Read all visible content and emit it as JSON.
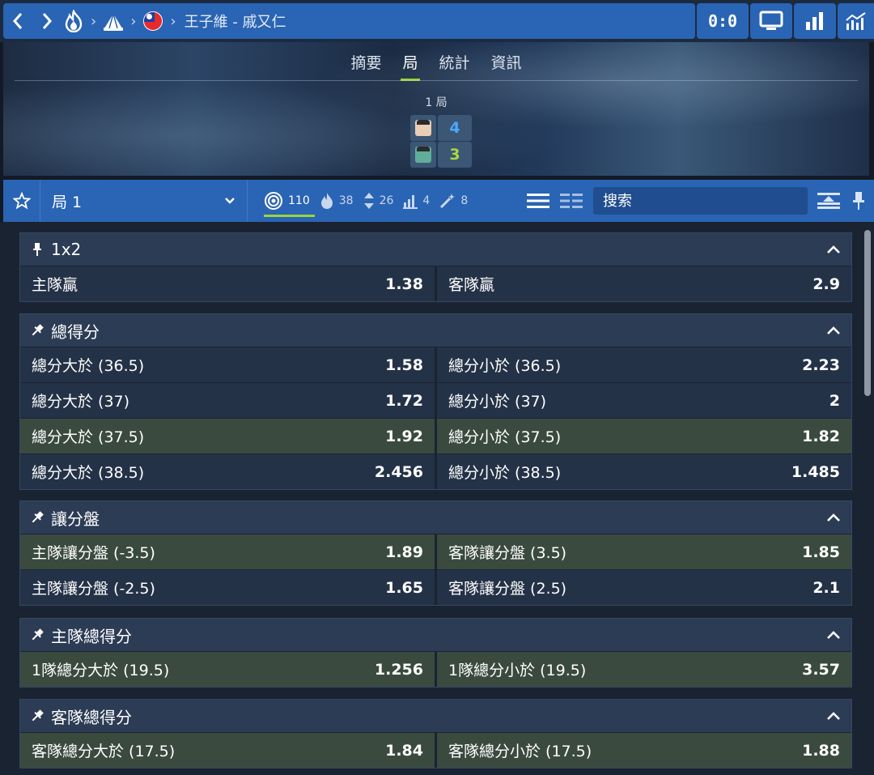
{
  "header": {
    "match_title": "王子維 - 戚又仁",
    "score": "0:0"
  },
  "hero": {
    "tabs": [
      {
        "label": "摘要",
        "active": false
      },
      {
        "label": "局",
        "active": true
      },
      {
        "label": "統計",
        "active": false
      },
      {
        "label": "資訊",
        "active": false
      }
    ],
    "set_label": "1 局",
    "players": [
      {
        "score": "4",
        "color": "#4aa8ff"
      },
      {
        "score": "3",
        "color": "#a6d93a"
      }
    ]
  },
  "filter": {
    "period": "局 1",
    "counters": [
      {
        "icon": "target-icon",
        "count": "110",
        "active": true
      },
      {
        "icon": "fire-icon",
        "count": "38",
        "active": false
      },
      {
        "icon": "updown-icon",
        "count": "26",
        "active": false
      },
      {
        "icon": "bars-icon",
        "count": "4",
        "active": false
      },
      {
        "icon": "wand-icon",
        "count": "8",
        "active": false
      }
    ],
    "search_placeholder": "搜索"
  },
  "markets": [
    {
      "title": "1x2",
      "rows": [
        [
          {
            "label": "主隊贏",
            "odd": "1.38"
          },
          {
            "label": "客隊贏",
            "odd": "2.9"
          }
        ]
      ]
    },
    {
      "title": "總得分",
      "rows": [
        [
          {
            "label": "總分大於 (36.5)",
            "odd": "1.58"
          },
          {
            "label": "總分小於 (36.5)",
            "odd": "2.23"
          }
        ],
        [
          {
            "label": "總分大於 (37)",
            "odd": "1.72"
          },
          {
            "label": "總分小於 (37)",
            "odd": "2"
          }
        ],
        [
          {
            "label": "總分大於 (37.5)",
            "odd": "1.92"
          },
          {
            "label": "總分小於 (37.5)",
            "odd": "1.82"
          }
        ],
        [
          {
            "label": "總分大於 (38.5)",
            "odd": "2.456"
          },
          {
            "label": "總分小於 (38.5)",
            "odd": "1.485"
          }
        ]
      ]
    },
    {
      "title": "讓分盤",
      "rows": [
        [
          {
            "label": "主隊讓分盤 (-3.5)",
            "odd": "1.89"
          },
          {
            "label": "客隊讓分盤 (3.5)",
            "odd": "1.85"
          }
        ],
        [
          {
            "label": "主隊讓分盤 (-2.5)",
            "odd": "1.65"
          },
          {
            "label": "客隊讓分盤 (2.5)",
            "odd": "2.1"
          }
        ]
      ]
    },
    {
      "title": "主隊總得分",
      "rows": [
        [
          {
            "label": "1隊總分大於 (19.5)",
            "odd": "1.256"
          },
          {
            "label": "1隊總分小於 (19.5)",
            "odd": "3.57"
          }
        ]
      ]
    },
    {
      "title": "客隊總得分",
      "rows": [
        [
          {
            "label": "客隊總分大於 (17.5)",
            "odd": "1.84"
          },
          {
            "label": "客隊總分小於 (17.5)",
            "odd": "1.88"
          }
        ]
      ]
    }
  ],
  "colors": {
    "accent_blue": "#2a64b4",
    "accent_green": "#9cd43a",
    "highlight_row": "#3a4a3f"
  }
}
